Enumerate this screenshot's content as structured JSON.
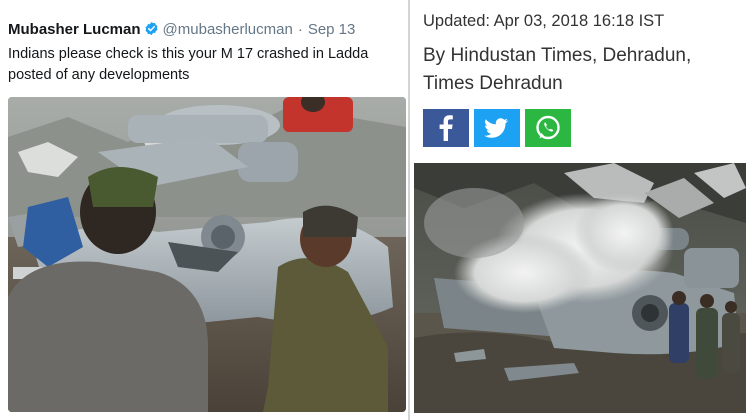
{
  "tweet": {
    "author_name": "Mubasher Lucman",
    "author_handle": "@mubasherlucman",
    "separator": "·",
    "date": "Sep 13",
    "text_line1": "Indians please check is this your M 17 crashed in Ladda",
    "text_line2": "posted of any developments",
    "verified_icon": "verified-badge-icon",
    "colors": {
      "name": "#14171a",
      "meta": "#657786",
      "verified": "#1da1f2"
    }
  },
  "article": {
    "updated": "Updated: Apr 03, 2018 16:18 IST",
    "byline_line1": "By Hindustan Times, Dehradun,",
    "byline_line2": "Times Dehradun",
    "share_buttons": [
      {
        "icon": "facebook-icon",
        "color": "#3b5998"
      },
      {
        "icon": "twitter-icon",
        "color": "#1da1f2"
      },
      {
        "icon": "whatsapp-icon",
        "color": "#2bb741"
      }
    ]
  }
}
